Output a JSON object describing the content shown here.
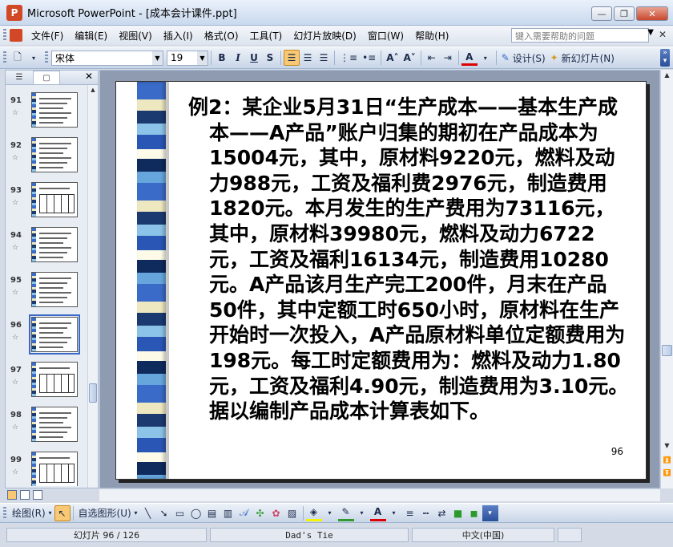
{
  "window": {
    "title": "Microsoft PowerPoint - [成本会计课件.ppt]",
    "app_icon": "P",
    "minimize": "—",
    "restore": "❐",
    "close": "✕"
  },
  "menu": {
    "items": [
      "文件(F)",
      "编辑(E)",
      "视图(V)",
      "插入(I)",
      "格式(O)",
      "工具(T)",
      "幻灯片放映(D)",
      "窗口(W)",
      "帮助(H)"
    ],
    "help_placeholder": "键入需要帮助的问题",
    "doc_close": "✕"
  },
  "toolbar": {
    "font": "宋体",
    "size": "19",
    "bold": "B",
    "italic": "I",
    "underline": "U",
    "shadow": "S",
    "design": "设计(S)",
    "new_slide": "新幻灯片(N)",
    "font_grow": "A˄",
    "font_shrink": "A˅",
    "font_color": "A"
  },
  "panel": {
    "tab_outline": "☰",
    "tab_slides": "▢",
    "close": "✕",
    "thumbnails": [
      {
        "num": "91",
        "star": "☆",
        "kind": "text"
      },
      {
        "num": "92",
        "star": "☆",
        "kind": "text"
      },
      {
        "num": "93",
        "star": "☆",
        "kind": "table"
      },
      {
        "num": "94",
        "star": "☆",
        "kind": "text"
      },
      {
        "num": "95",
        "star": "☆",
        "kind": "text"
      },
      {
        "num": "96",
        "star": "☆",
        "kind": "text",
        "selected": true
      },
      {
        "num": "97",
        "star": "☆",
        "kind": "table"
      },
      {
        "num": "98",
        "star": "☆",
        "kind": "text"
      },
      {
        "num": "99",
        "star": "☆",
        "kind": "table"
      }
    ]
  },
  "slide": {
    "paragraph": "例2：某企业5月31日“生产成本——基本生产成本——A产品”账户归集的期初在产品成本为15004元，其中，原材料9220元，燃料及动力988元，工资及福利费2976元，制造费用1820元。本月发生的生产费用为73116元，其中，原材料39980元，燃料及动力6722元，工资及福利16134元，制造费用10280元。A产品该月生产完工200件，月末在产品50件，其中定额工时650小时，原材料在生产开始时一次投入，A产品原材料单位定额费用为198元。每工时定额费用为：燃料及动力1.80元，工资及福利4.90元，制造费用为3.10元。据以编制产品成本计算表如下。",
    "number": "96"
  },
  "drawbar": {
    "draw": "绘图(R)",
    "autoshapes": "自选图形(U)"
  },
  "status": {
    "slide_pos": "幻灯片 96 / 126",
    "theme": "Dad's Tie",
    "language": "中文(中国)"
  }
}
